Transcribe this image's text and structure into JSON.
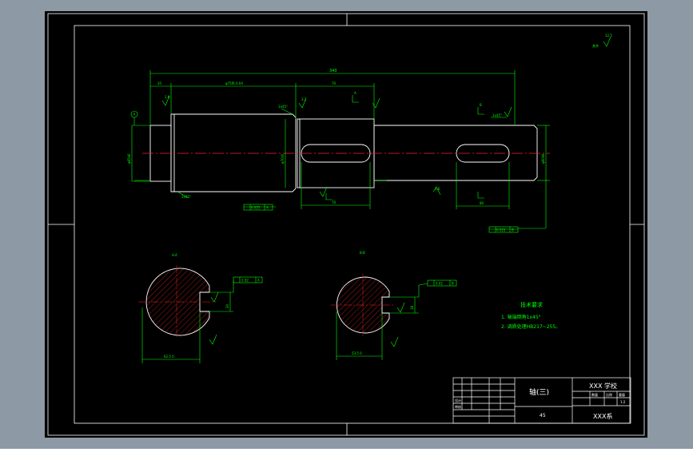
{
  "colors": {
    "viewport_bg": "#8d99a5",
    "canvas": "#000000",
    "line": "#ffffff",
    "dim": "#00ff00",
    "center": "#ff2020",
    "hatch": "#ff3030"
  },
  "drawing": {
    "tech_title": "技术要求",
    "tech_req_1": "1. 轴端倒角1x45°",
    "tech_req_2": "2. 调质处理HB217~255。",
    "surface_finish": "12.5",
    "surface_finish_note": "其余"
  },
  "dims": {
    "overall_length": "340",
    "left_step": "35",
    "seg_length": "φ75f6 0.04",
    "key_len_top": "70",
    "key_len_left": "70",
    "key_len_right": "80",
    "chamfer_a": "1x45°",
    "chamfer_b": "1x45°",
    "chamfer_c": "1x45°",
    "tol_a": "0.025",
    "tol_b": "0.025",
    "roughness_a": "1.6",
    "roughness_b": "3.2",
    "roughness_c": "1.6",
    "dia_left": "φ65k6",
    "dia_mid": "φ70r6",
    "dia_right": "φ60k6",
    "section_width_a": "62.5 0",
    "section_width_b": "53.5 0",
    "key_depth_a": "20",
    "key_depth_b": "18",
    "tol_section_a": "0.02",
    "tol_section_b": "0.02",
    "datum_a": "A",
    "datum_b": "B",
    "section_a_label": "A-A",
    "section_b_label": "B-B",
    "mark_a": "A",
    "mark_b": "B"
  },
  "titleblock": {
    "part_name": "轴(三)",
    "school": "XXX 学校",
    "company": "XXX系",
    "material": "45",
    "scale_head": "比例",
    "qty_head": "数量",
    "weight_head": "重量",
    "row_design": "设计",
    "row_check": "审核",
    "scale_val": "1:2"
  }
}
